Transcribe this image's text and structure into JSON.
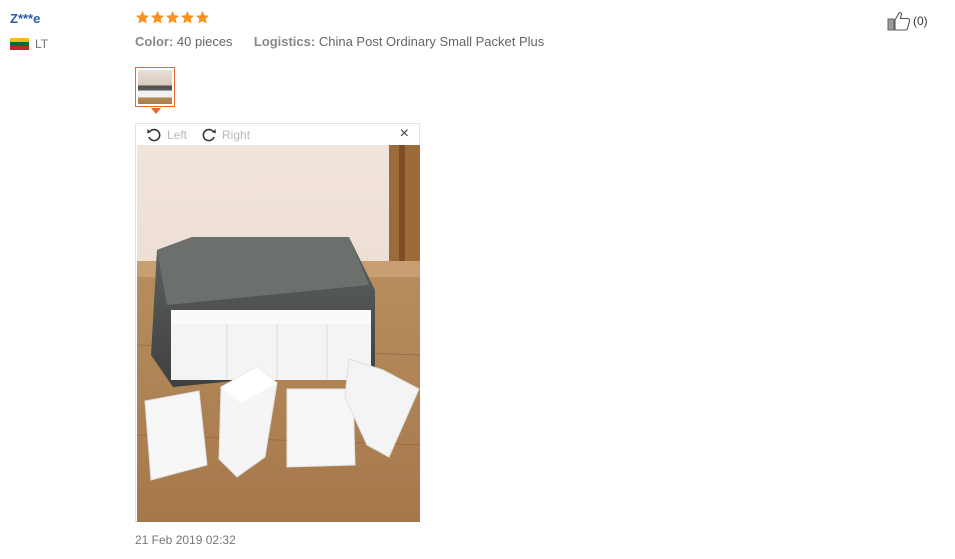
{
  "reviewer": {
    "name": "Z***e",
    "country": "LT"
  },
  "rating": {
    "stars": 5,
    "max": 5
  },
  "meta": {
    "color_label": "Color:",
    "color_value": "40 pieces",
    "logistics_label": "Logistics:",
    "logistics_value": "China Post Ordinary Small Packet Plus"
  },
  "helpful": {
    "count_text": "(0)",
    "icon": "thumbs-up-icon"
  },
  "viewer": {
    "rotate_left_label": "Left",
    "rotate_right_label": "Right",
    "close_glyph": "×"
  },
  "review_date": "21 Feb 2019 02:32",
  "colors": {
    "star": "#f7931e",
    "accent": "#e8662e",
    "username": "#2a5ca8"
  }
}
